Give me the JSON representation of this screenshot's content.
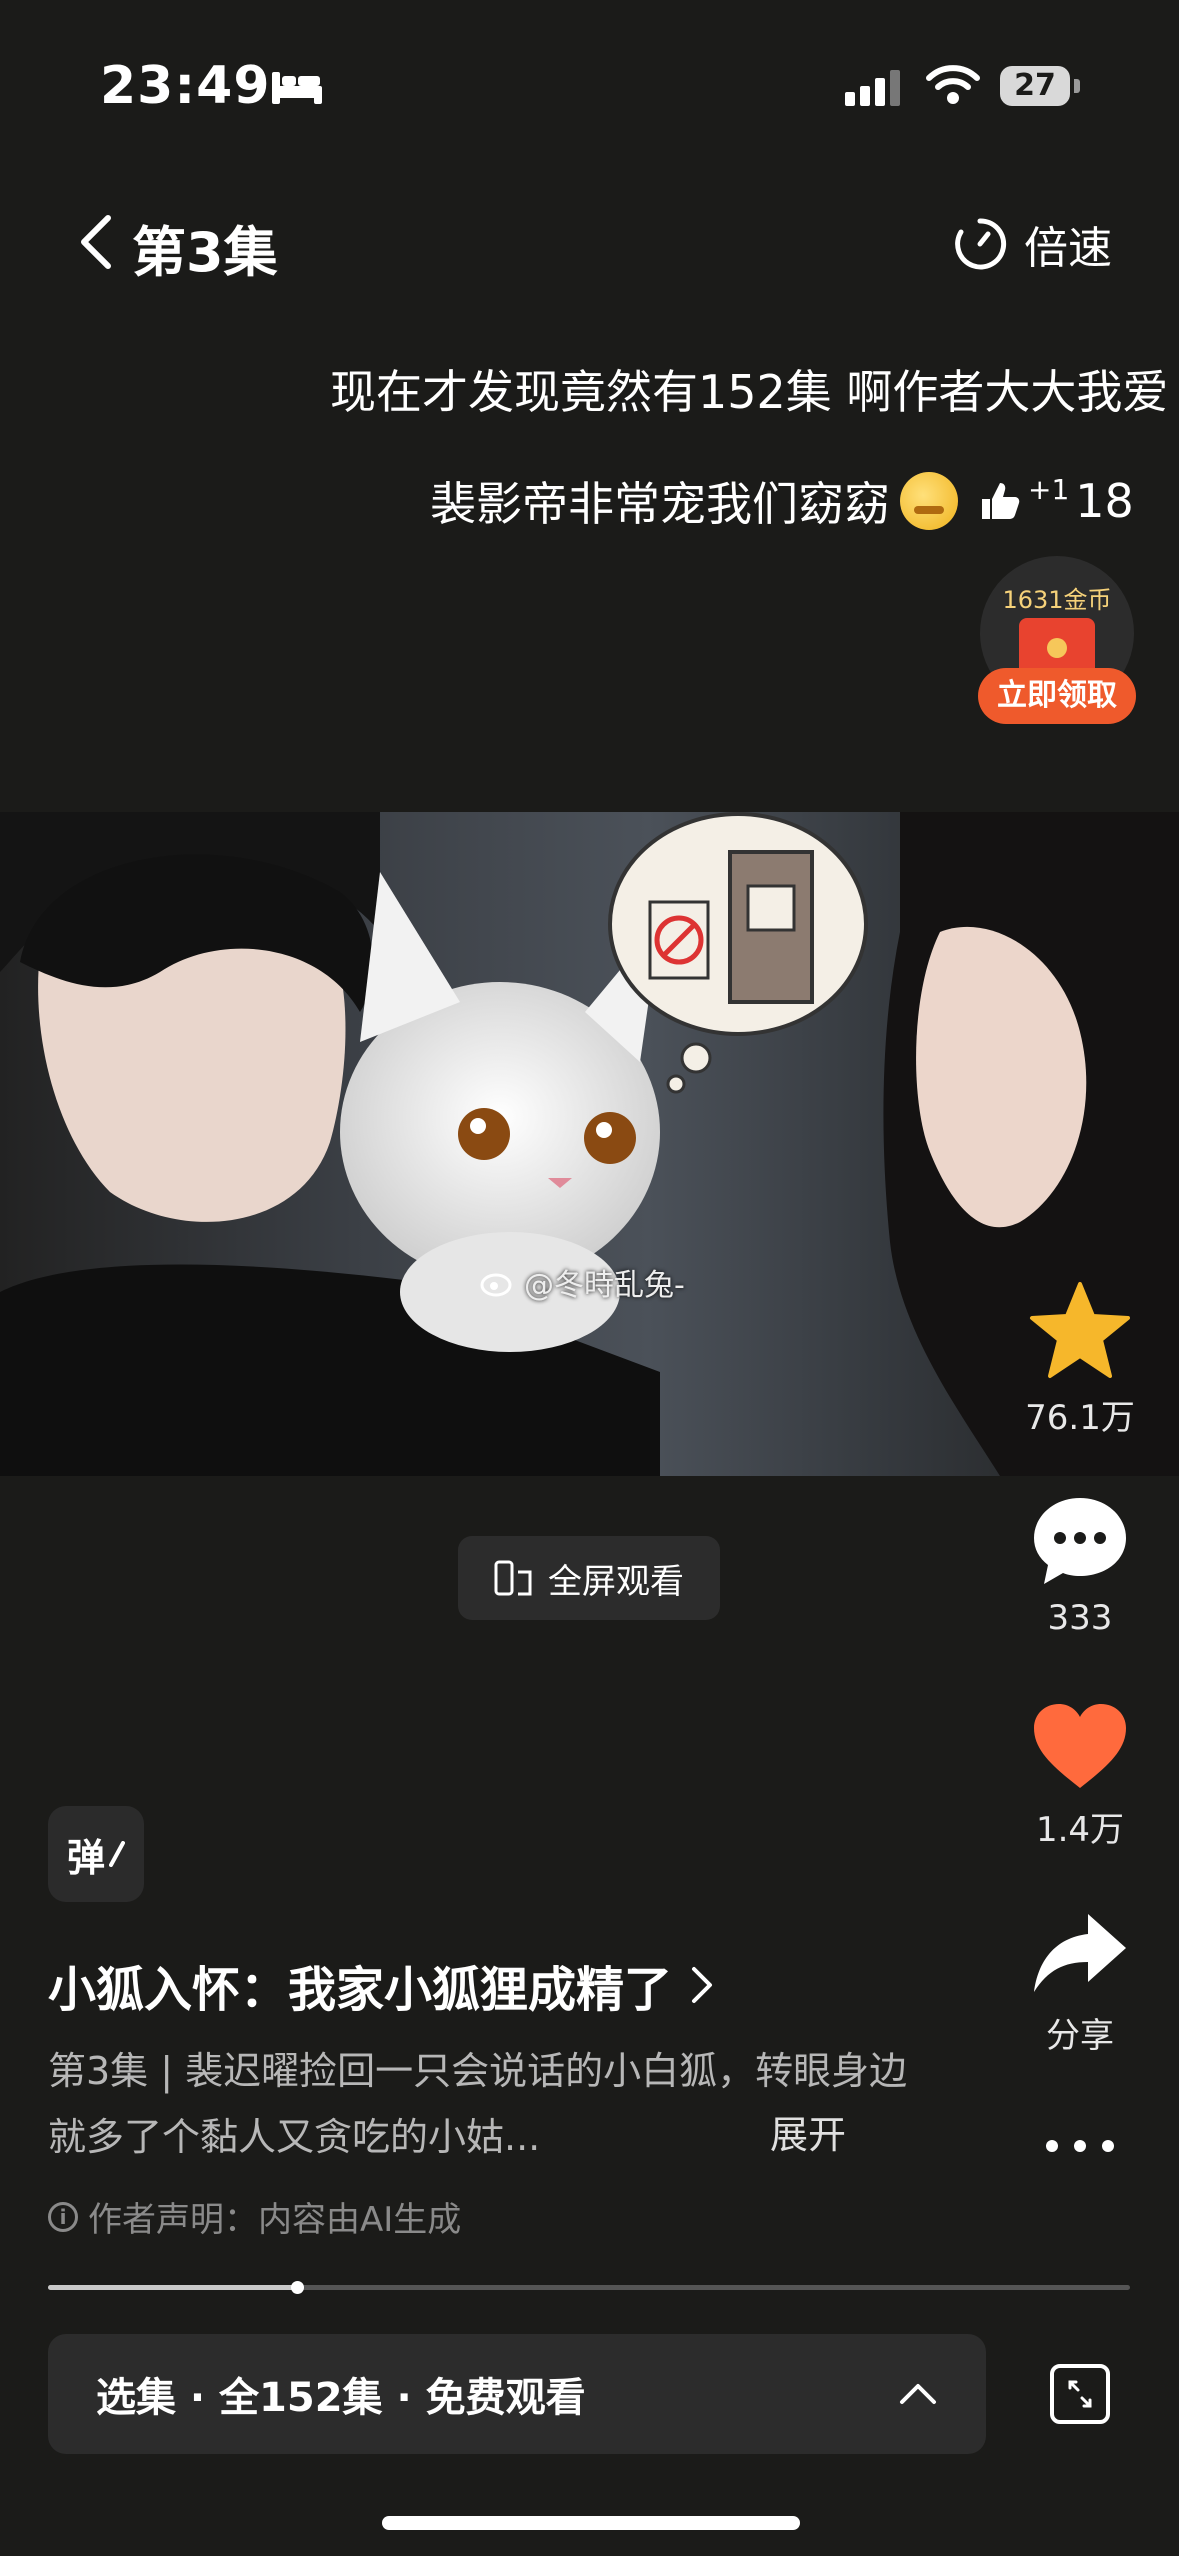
{
  "status_bar": {
    "time": "23:49",
    "battery": "27"
  },
  "header": {
    "title": "第3集",
    "speed_label": "倍速"
  },
  "danmaku": {
    "comment_1": "现在才发现竟然有152集 啊作者大大我爱",
    "comment_2": "裴影帝非常宠我们窈窈",
    "like_plus": "+1",
    "like_count": "18"
  },
  "reward": {
    "amount": "1631金币",
    "button": "立即领取"
  },
  "video": {
    "watermark": "@冬時乱兔-",
    "fullscreen_label": "全屏观看"
  },
  "actions": {
    "collect_count": "76.1万",
    "comment_count": "333",
    "like_count": "1.4万",
    "share_label": "分享"
  },
  "danmaku_toggle": "弹",
  "series": {
    "title": "小狐入怀：我家小狐狸成精了",
    "description": "第3集 | 裴迟曜捡回一只会说话的小白狐，转眼身边就多了个黏人又贪吃的小姑...",
    "expand": "展开",
    "disclaimer": "作者声明：内容由AI生成"
  },
  "playback": {
    "progress": 0.23
  },
  "episode_bar": {
    "label": "选集 · 全152集 · 免费观看"
  },
  "colors": {
    "accent": "#ef5a2c",
    "star": "#f6b72b",
    "heart": "#ff6a3d"
  }
}
